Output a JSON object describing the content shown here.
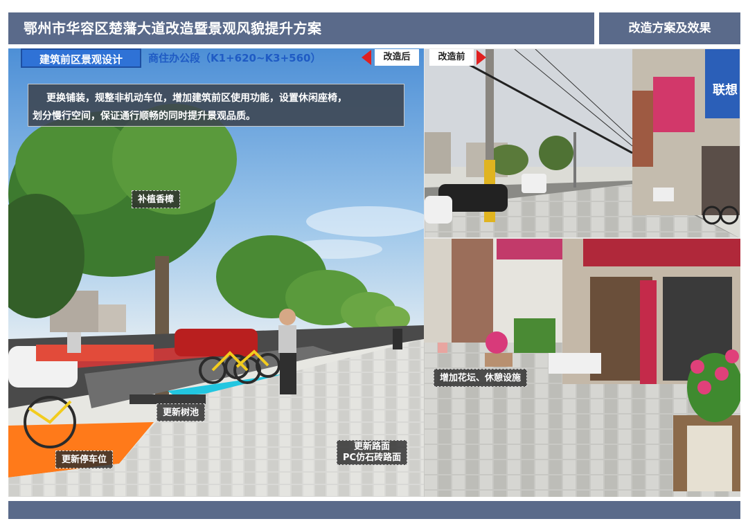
{
  "header": {
    "title": "鄂州市华容区楚藩大道改造暨景观风貌提升方案",
    "section": "改造方案及效果"
  },
  "panel": {
    "tag": "建筑前区景观设计",
    "subtitle": "商住办公段（K1+620~K3+560）",
    "after_label": "改造后",
    "before_label": "改造前",
    "description_line1": "更换铺装，规整非机动车位，增加建筑前区使用功能，设置休闲座椅，",
    "description_line2": "划分慢行空间，保证通行顺畅的同时提升景观品质。"
  },
  "annotations": {
    "tree": "补植香樟",
    "tree_pit": "更新树池",
    "parking": "更新停车位",
    "pavement_line1": "更新路面",
    "pavement_line2": "PC仿石砖路面",
    "flowers": "增加花坛、休憩设施"
  },
  "storefront_signs": {
    "brand": "联想"
  },
  "colors": {
    "header_bar": "#5a6a8a",
    "tag_blue": "#2f72d6",
    "subtitle_blue": "#1f5bc4",
    "arrow_red": "#e02020",
    "bike_lane": "#ff7a1a",
    "parking_blue": "#22c6e0"
  }
}
